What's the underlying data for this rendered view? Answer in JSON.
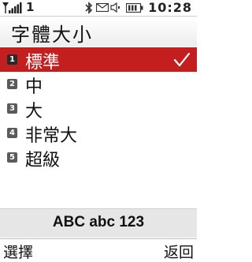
{
  "status_bar": {
    "signal_number": "1",
    "time": "10:28"
  },
  "screen": {
    "title": "字體大小"
  },
  "options": [
    {
      "number": "1",
      "label": "標準",
      "selected": true
    },
    {
      "number": "2",
      "label": "中",
      "selected": false
    },
    {
      "number": "3",
      "label": "大",
      "selected": false
    },
    {
      "number": "4",
      "label": "非常大",
      "selected": false
    },
    {
      "number": "5",
      "label": "超級",
      "selected": false
    }
  ],
  "preview": {
    "text": "ABC abc 123"
  },
  "softkeys": {
    "left": "選擇",
    "right": "返回"
  },
  "colors": {
    "selection": "#c41f1f"
  }
}
